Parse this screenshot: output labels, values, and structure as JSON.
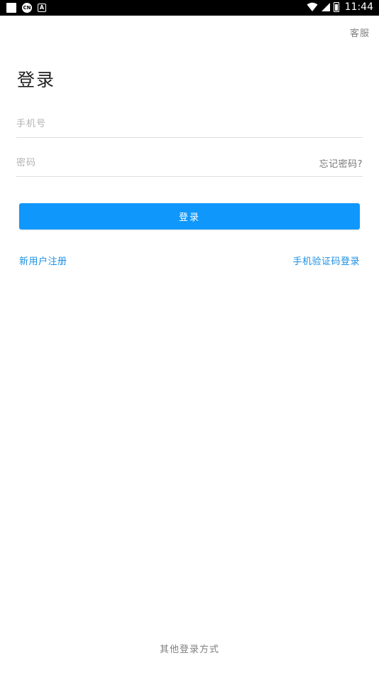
{
  "status_bar": {
    "time": "11:44",
    "icons": [
      "notification-square-icon",
      "app-circle-icon",
      "font-a-icon",
      "wifi-icon",
      "cell-signal-icon",
      "battery-icon"
    ],
    "badge_round": "CN",
    "badge_a": "A"
  },
  "header": {
    "service_label": "客服",
    "title": "登录"
  },
  "form": {
    "phone_placeholder": "手机号",
    "phone_value": "",
    "password_placeholder": "密码",
    "password_value": "",
    "forgot_label": "忘记密码?",
    "submit_label": "登录"
  },
  "links": {
    "register": "新用户注册",
    "sms_login": "手机验证码登录"
  },
  "footer": {
    "other_login": "其他登录方式"
  },
  "colors": {
    "primary": "#1097fb",
    "link": "#1a8fe3",
    "muted": "#808080"
  }
}
